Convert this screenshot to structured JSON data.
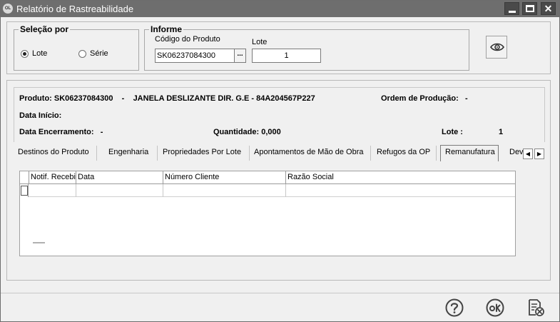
{
  "window": {
    "title": "Relatório de Rastreabilidade",
    "app_icon_text": "OL"
  },
  "selecao": {
    "title": "Seleção por",
    "options": [
      {
        "label": "Lote",
        "checked": true
      },
      {
        "label": "Série",
        "checked": false
      }
    ]
  },
  "informe": {
    "title": "Informe",
    "codigo_label": "Código do Produto",
    "codigo_value": "SK06237084300",
    "browse_label": "...",
    "lote_label": "Lote",
    "lote_value": "1"
  },
  "info": {
    "produto": "Produto: SK06237084300    -    JANELA DESLIZANTE DIR. G.E - 84A204567P227",
    "ordem_producao": "Ordem de Produção:   -",
    "data_inicio": "Data Início:",
    "data_encerramento": "Data Encerramento:   -",
    "quantidade": "Quantidade: 0,000",
    "lote_label": "Lote :",
    "lote_value": "1"
  },
  "tabs": [
    {
      "label": "Destinos do Produto",
      "active": false
    },
    {
      "label": "Engenharia",
      "active": false
    },
    {
      "label": "Propriedades Por Lote",
      "active": false
    },
    {
      "label": "Apontamentos de Mão de Obra",
      "active": false
    },
    {
      "label": "Refugos da OP",
      "active": false
    },
    {
      "label": "Remanufatura",
      "active": true
    },
    {
      "label": "Devo",
      "active": false
    }
  ],
  "tab_scroll": {
    "left": "◀",
    "right": "▶"
  },
  "grid": {
    "columns": [
      "Notif. Recebi",
      "Data",
      "Número Cliente",
      "Razão Social"
    ]
  },
  "footer": {
    "buttons": [
      "help-icon",
      "ok-icon",
      "cancel-report-icon"
    ]
  },
  "colors": {
    "titlebar": "#6e6e6e",
    "background": "#f0f0f0"
  }
}
